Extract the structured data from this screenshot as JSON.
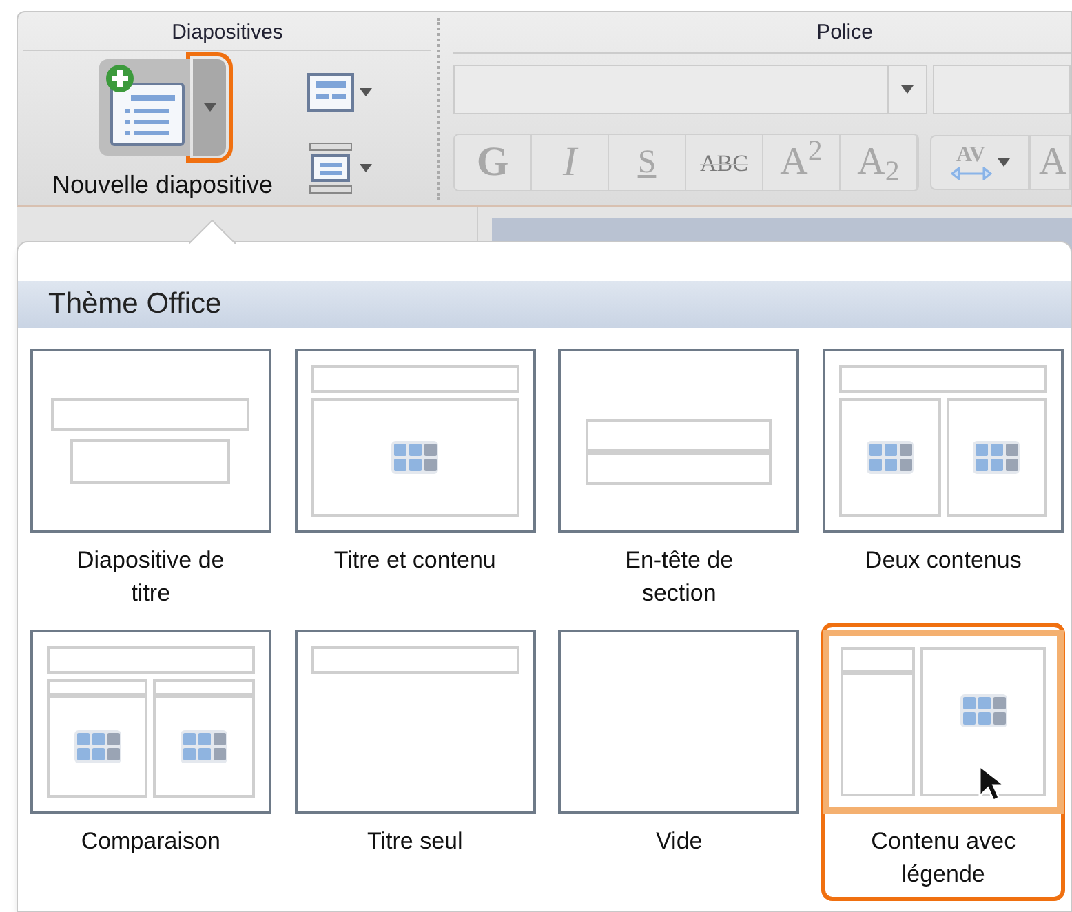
{
  "ribbon": {
    "groups": [
      {
        "title": "Diapositives"
      },
      {
        "title": "Police"
      }
    ],
    "new_slide": {
      "label": "Nouvelle diapositive",
      "dropdown_highlighted": true
    },
    "font_buttons": [
      {
        "label": "G",
        "kind": "bold",
        "disabled": true
      },
      {
        "label": "I",
        "kind": "italic",
        "disabled": true
      },
      {
        "label": "S",
        "kind": "underline",
        "disabled": true
      },
      {
        "label": "ABC",
        "kind": "strike",
        "disabled": true
      },
      {
        "label": "A$^{2}$",
        "kind": "super",
        "disabled": true
      },
      {
        "label": "A$_{2}$",
        "kind": "sub",
        "disabled": true
      }
    ],
    "spacing_button": {
      "label": "AV",
      "disabled": true
    },
    "cut_button": {
      "label": "A"
    }
  },
  "gallery": {
    "title": "Thème Office",
    "layouts": [
      {
        "label": "Diapositive de titre",
        "kind": "title",
        "selected": false
      },
      {
        "label": "Titre et contenu",
        "kind": "title_content",
        "selected": false
      },
      {
        "label": "En-tête de section",
        "kind": "section",
        "selected": false
      },
      {
        "label": "Deux contenus",
        "kind": "two_content",
        "selected": false
      },
      {
        "label": "Comparaison",
        "kind": "comparison",
        "selected": false
      },
      {
        "label": "Titre seul",
        "kind": "title_only",
        "selected": false
      },
      {
        "label": "Vide",
        "kind": "blank",
        "selected": false
      },
      {
        "label": "Contenu avec légende",
        "kind": "content_caption",
        "selected": true
      }
    ]
  }
}
